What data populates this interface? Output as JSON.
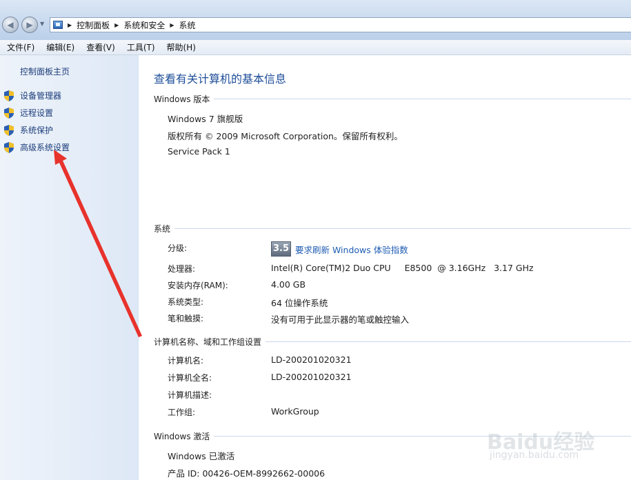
{
  "address": {
    "crumbs": [
      "控制面板",
      "系统和安全",
      "系统"
    ]
  },
  "menu": [
    "文件(F)",
    "编辑(E)",
    "查看(V)",
    "工具(T)",
    "帮助(H)"
  ],
  "sidebar": {
    "home": "控制面板主页",
    "links": [
      "设备管理器",
      "远程设置",
      "系统保护",
      "高级系统设置"
    ]
  },
  "main": {
    "title": "查看有关计算机的基本信息",
    "windows_edition": {
      "heading": "Windows 版本",
      "edition": "Windows 7 旗舰版",
      "copyright": "版权所有 © 2009 Microsoft Corporation。保留所有权利。",
      "service_pack": "Service Pack 1"
    },
    "system": {
      "heading": "系统",
      "rating_label": "分级:",
      "rating_score": "3.5",
      "rating_link": "要求刷新 Windows 体验指数",
      "processor_label": "处理器:",
      "processor_value": "Intel(R) Core(TM)2 Duo CPU     E8500  @ 3.16GHz   3.17 GHz",
      "ram_label": "安装内存(RAM):",
      "ram_value": "4.00 GB",
      "type_label": "系统类型:",
      "type_value": "64 位操作系统",
      "pen_label": "笔和触摸:",
      "pen_value": "没有可用于此显示器的笔或触控输入"
    },
    "computer": {
      "heading": "计算机名称、域和工作组设置",
      "name_label": "计算机名:",
      "name_value": "LD-200201020321",
      "fullname_label": "计算机全名:",
      "fullname_value": "LD-200201020321",
      "desc_label": "计算机描述:",
      "workgroup_label": "工作组:",
      "workgroup_value": "WorkGroup"
    },
    "activation": {
      "heading": "Windows 激活",
      "status": "Windows 已激活",
      "product_id": "产品 ID: 00426-OEM-8992662-00006"
    }
  },
  "watermark": {
    "brand": "Baidu经验",
    "url": "jingyan.baidu.com"
  },
  "colors": {
    "link": "#1c3d7a",
    "title": "#1e4e99",
    "annotation_arrow": "#e8322c"
  }
}
